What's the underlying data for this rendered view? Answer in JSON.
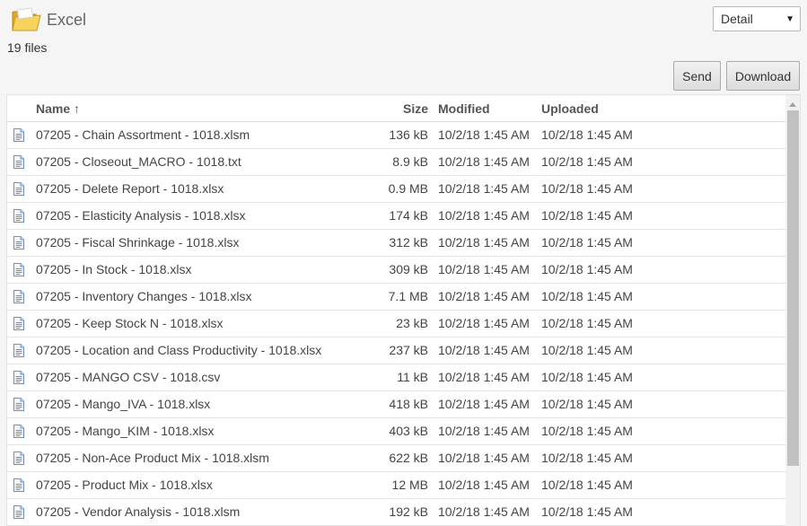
{
  "header": {
    "title": "Excel",
    "icon": "folder-icon"
  },
  "view_select": {
    "value": "Detail"
  },
  "file_count": "19 files",
  "actions": {
    "send_label": "Send",
    "download_label": "Download"
  },
  "table": {
    "columns": {
      "name": "Name ↑",
      "size": "Size",
      "modified": "Modified",
      "uploaded": "Uploaded"
    },
    "rows": [
      {
        "name": "07205 - Chain Assortment - 1018.xlsm",
        "size": "136 kB",
        "modified": "10/2/18 1:45 AM",
        "uploaded": "10/2/18 1:45 AM"
      },
      {
        "name": "07205 - Closeout_MACRO - 1018.txt",
        "size": "8.9 kB",
        "modified": "10/2/18 1:45 AM",
        "uploaded": "10/2/18 1:45 AM"
      },
      {
        "name": "07205 - Delete Report - 1018.xlsx",
        "size": "0.9 MB",
        "modified": "10/2/18 1:45 AM",
        "uploaded": "10/2/18 1:45 AM"
      },
      {
        "name": "07205 - Elasticity Analysis - 1018.xlsx",
        "size": "174 kB",
        "modified": "10/2/18 1:45 AM",
        "uploaded": "10/2/18 1:45 AM"
      },
      {
        "name": "07205 - Fiscal Shrinkage - 1018.xlsx",
        "size": "312 kB",
        "modified": "10/2/18 1:45 AM",
        "uploaded": "10/2/18 1:45 AM"
      },
      {
        "name": "07205 - In Stock - 1018.xlsx",
        "size": "309 kB",
        "modified": "10/2/18 1:45 AM",
        "uploaded": "10/2/18 1:45 AM"
      },
      {
        "name": "07205 - Inventory Changes - 1018.xlsx",
        "size": "7.1 MB",
        "modified": "10/2/18 1:45 AM",
        "uploaded": "10/2/18 1:45 AM"
      },
      {
        "name": "07205 - Keep Stock N - 1018.xlsx",
        "size": "23 kB",
        "modified": "10/2/18 1:45 AM",
        "uploaded": "10/2/18 1:45 AM"
      },
      {
        "name": "07205 - Location and Class Productivity - 1018.xlsx",
        "size": "237 kB",
        "modified": "10/2/18 1:45 AM",
        "uploaded": "10/2/18 1:45 AM"
      },
      {
        "name": "07205 - MANGO CSV - 1018.csv",
        "size": "11 kB",
        "modified": "10/2/18 1:45 AM",
        "uploaded": "10/2/18 1:45 AM"
      },
      {
        "name": "07205 - Mango_IVA - 1018.xlsx",
        "size": "418 kB",
        "modified": "10/2/18 1:45 AM",
        "uploaded": "10/2/18 1:45 AM"
      },
      {
        "name": "07205 - Mango_KIM - 1018.xlsx",
        "size": "403 kB",
        "modified": "10/2/18 1:45 AM",
        "uploaded": "10/2/18 1:45 AM"
      },
      {
        "name": "07205 - Non-Ace Product Mix - 1018.xlsm",
        "size": "622 kB",
        "modified": "10/2/18 1:45 AM",
        "uploaded": "10/2/18 1:45 AM"
      },
      {
        "name": "07205 - Product Mix - 1018.xlsx",
        "size": "12 MB",
        "modified": "10/2/18 1:45 AM",
        "uploaded": "10/2/18 1:45 AM"
      },
      {
        "name": "07205 - Vendor Analysis - 1018.xlsm",
        "size": "192 kB",
        "modified": "10/2/18 1:45 AM",
        "uploaded": "10/2/18 1:45 AM"
      }
    ]
  },
  "colors": {
    "folder": "#f5c542",
    "doc_icon": "#6b8fc7"
  }
}
